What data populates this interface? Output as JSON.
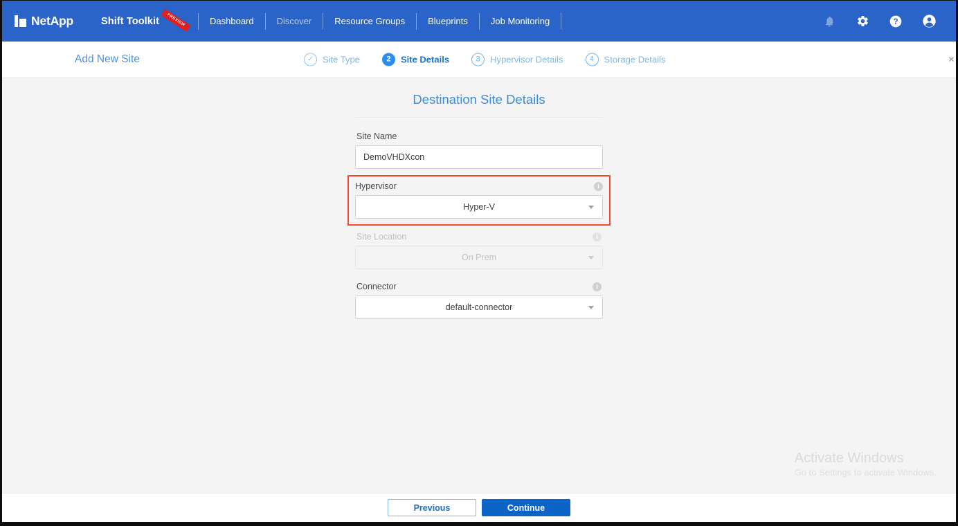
{
  "topbar": {
    "brand": "NetApp",
    "product": "Shift Toolkit",
    "badge": "PREVIEW",
    "nav": [
      {
        "label": "Dashboard",
        "active": true
      },
      {
        "label": "Discover",
        "active": false
      },
      {
        "label": "Resource Groups",
        "active": true
      },
      {
        "label": "Blueprints",
        "active": true
      },
      {
        "label": "Job Monitoring",
        "active": true
      }
    ],
    "icons": [
      {
        "name": "bell-icon",
        "label": "Notifications"
      },
      {
        "name": "gear-icon",
        "label": "Settings"
      },
      {
        "name": "help-icon",
        "label": "Help"
      },
      {
        "name": "account-icon",
        "label": "Account"
      }
    ],
    "accent": "#2a64c8"
  },
  "wizard": {
    "title": "Add New Site",
    "close_label": "×",
    "steps": [
      {
        "marker": "✓",
        "label": "Site Type",
        "state": "done"
      },
      {
        "marker": "2",
        "label": "Site Details",
        "state": "active"
      },
      {
        "marker": "3",
        "label": "Hypervisor Details",
        "state": "todo"
      },
      {
        "marker": "4",
        "label": "Storage Details",
        "state": "todo"
      }
    ]
  },
  "form": {
    "heading": "Destination Site Details",
    "fields": {
      "site_name": {
        "label": "Site Name",
        "value": "DemoVHDXcon",
        "placeholder": "Site Name"
      },
      "hypervisor": {
        "label": "Hypervisor",
        "value": "Hyper-V",
        "info": "i",
        "highlight_color": "#f8462c"
      },
      "site_location": {
        "label": "Site Location",
        "value": "On Prem",
        "info": "i",
        "state": "disabled"
      },
      "connector": {
        "label": "Connector",
        "value": "default-connector",
        "info": "i"
      }
    }
  },
  "footer": {
    "previous_label": "Previous",
    "continue_label": "Continue"
  },
  "watermark": {
    "title": "Activate Windows",
    "subtitle": "Go to Settings to activate Windows."
  }
}
